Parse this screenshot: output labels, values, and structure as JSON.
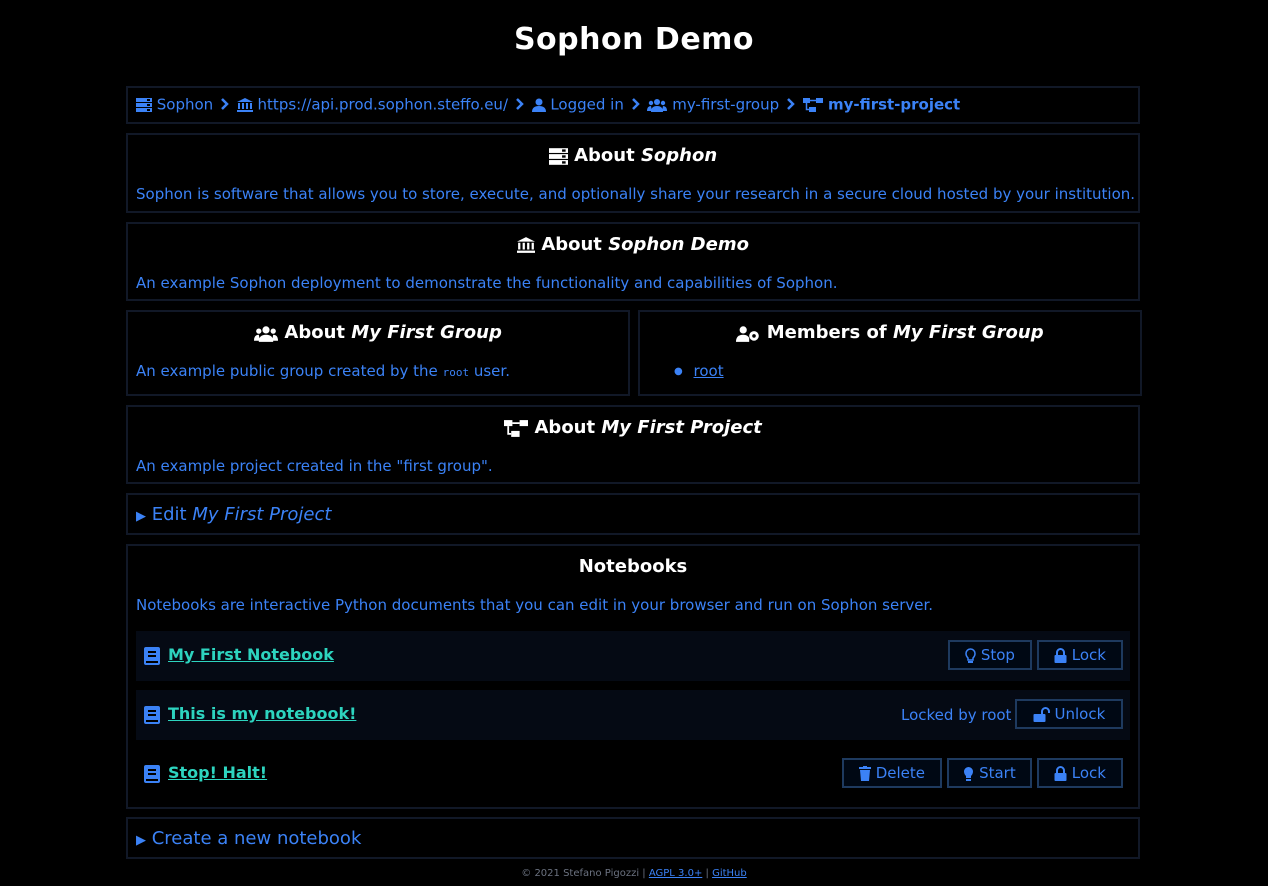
{
  "page_title": "Sophon Demo",
  "breadcrumb": {
    "items": [
      {
        "label": "Sophon",
        "icon": "server-icon"
      },
      {
        "label": "https://api.prod.sophon.steffo.eu/",
        "icon": "institution-icon"
      },
      {
        "label": "Logged in",
        "icon": "user-icon"
      },
      {
        "label": "my-first-group",
        "icon": "group-icon"
      },
      {
        "label": "my-first-project",
        "icon": "project-icon"
      }
    ]
  },
  "about_sophon": {
    "prefix": "About",
    "name": "Sophon",
    "description": "Sophon is software that allows you to store, execute, and optionally share your research in a secure cloud hosted by your institution."
  },
  "about_instance": {
    "prefix": "About",
    "name": "Sophon Demo",
    "description": "An example Sophon deployment to demonstrate the functionality and capabilities of Sophon."
  },
  "about_group": {
    "prefix": "About",
    "name": "My First Group",
    "description_before": "An example public group created by the",
    "description_code": "root",
    "description_after": "user."
  },
  "members": {
    "prefix": "Members of",
    "name": "My First Group",
    "list": [
      "root"
    ]
  },
  "about_project": {
    "prefix": "About",
    "name": "My First Project",
    "description": "An example project created in the \"first group\"."
  },
  "edit_project": {
    "prefix": "Edit",
    "name": "My First Project"
  },
  "notebooks": {
    "title": "Notebooks",
    "description": "Notebooks are interactive Python documents that you can edit in your browser and run on Sophon server.",
    "items": [
      {
        "name": "My First Notebook",
        "buttons": [
          "Stop",
          "Lock"
        ]
      },
      {
        "name": "This is my notebook!",
        "locked_text": "Locked by root",
        "buttons": [
          "Unlock"
        ]
      },
      {
        "name": "Stop! Halt!",
        "buttons": [
          "Delete",
          "Start",
          "Lock"
        ]
      }
    ]
  },
  "create_notebook": {
    "label": "Create a new notebook"
  },
  "footer": {
    "copyright": "© 2021 Stefano Pigozzi |",
    "license": "AGPL 3.0+",
    "sep": "|",
    "source": "GitHub"
  },
  "colors": {
    "background": "#000000",
    "accent": "#3b82f6",
    "notebook_name": "#2dd4bf",
    "border": "#111827"
  }
}
